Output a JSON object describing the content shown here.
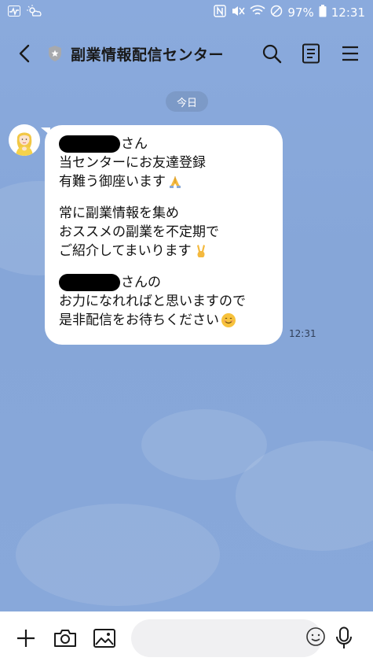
{
  "status_bar": {
    "battery": "97%",
    "time": "12:31"
  },
  "header": {
    "title": "副業情報配信センター"
  },
  "chat": {
    "date_chip": "今日",
    "message": {
      "line1_suffix": "さん",
      "line2": "当センターにお友達登録",
      "line3": "有難う御座います",
      "line4": "常に副業情報を集め",
      "line5": "おススメの副業を不定期で",
      "line6": "ご紹介してまいります",
      "line7_suffix": "さんの",
      "line8": "お力になれればと思いますので",
      "line9": "是非配信をお待ちください",
      "time": "12:31"
    }
  },
  "input": {
    "placeholder": ""
  },
  "colors": {
    "background": "#87a7d8",
    "bubble": "#ffffff",
    "text": "#111111"
  }
}
